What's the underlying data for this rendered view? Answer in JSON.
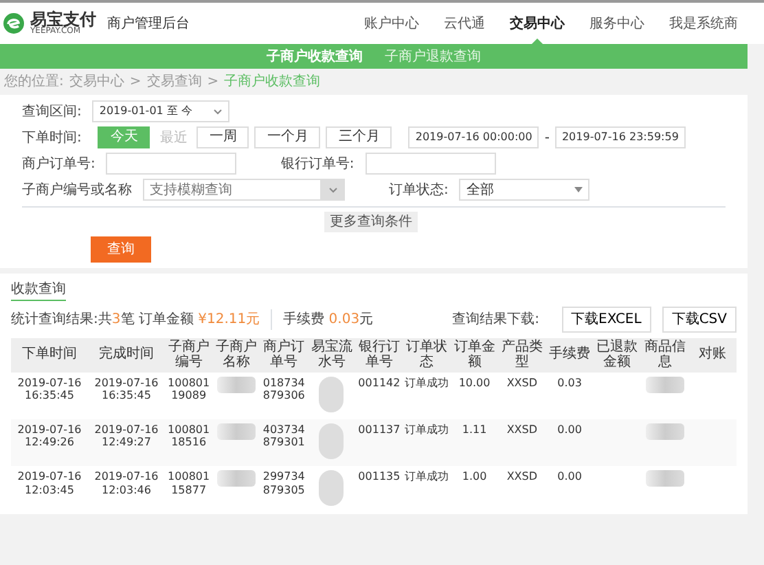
{
  "header": {
    "logo": "易宝支付",
    "logo_sub": "YEEPAY.COM",
    "title": "商户管理后台",
    "nav": [
      {
        "label": "账户中心",
        "selected": false
      },
      {
        "label": "云代通",
        "selected": false
      },
      {
        "label": "交易中心",
        "selected": true
      },
      {
        "label": "服务中心",
        "selected": false
      },
      {
        "label": "我是系统商",
        "selected": false
      }
    ]
  },
  "subnav": [
    {
      "label": "子商户收款查询",
      "selected": true
    },
    {
      "label": "子商户退款查询",
      "selected": false
    }
  ],
  "breadcrumb": {
    "prefix": "您的位置:",
    "separator": ">",
    "items": [
      "交易中心",
      "交易查询",
      "子商户收款查询"
    ]
  },
  "form": {
    "range_label": "查询区间:",
    "range_value": "2019-01-01 至 今",
    "time_label": "下单时间:",
    "quick": [
      {
        "label": "今天",
        "kind": "button",
        "selected": true
      },
      {
        "label": "最近",
        "kind": "label"
      },
      {
        "label": "一周",
        "kind": "button",
        "selected": false
      },
      {
        "label": "一个月",
        "kind": "button",
        "selected": false
      },
      {
        "label": "三个月",
        "kind": "button",
        "selected": false
      }
    ],
    "time_from": "2019-07-16 00:00:00",
    "time_sep": "-",
    "time_to": "2019-07-16 23:59:59",
    "merchant_order_label": "商户订单号:",
    "bank_order_label": "银行订单号:",
    "sub_merchant_label": "子商户编号或名称",
    "sub_merchant_placeholder": "支持模糊查询",
    "status_label": "订单状态:",
    "status_value": "全部",
    "more": "更多查询条件",
    "submit": "查询"
  },
  "results": {
    "tab": "收款查询",
    "stats_prefix": "统计查询结果:共",
    "count": "3",
    "stats_mid": "笔 订单金额",
    "amount": "¥12.11元",
    "fee_label": "手续费",
    "fee": "0.03",
    "fee_unit": "元",
    "download_label": "查询结果下载:",
    "downloads": [
      "下载EXCEL",
      "下载CSV"
    ]
  },
  "table": {
    "columns": [
      "下单时间",
      "完成时间",
      "子商户编号",
      "子商户名称",
      "商户订单号",
      "易宝流水号",
      "银行订单号",
      "订单状态",
      "订单金额",
      "产品类型",
      "手续费",
      "已退款金额",
      "商品信息",
      "对账"
    ],
    "rows": [
      {
        "cells": [
          {
            "text": "2019-07-16 16:35:45"
          },
          {
            "text": "2019-07-16 16:35:45"
          },
          {
            "text": "10080119089"
          },
          {
            "kind": "redacted"
          },
          {
            "text": "018734879306"
          },
          {
            "kind": "redacted"
          },
          {
            "text": "001142"
          },
          {
            "text": "订单成功"
          },
          {
            "text": "10.00"
          },
          {
            "text": "XXSD"
          },
          {
            "text": "0.03"
          },
          {
            "kind": "empty"
          },
          {
            "kind": "redacted"
          },
          {
            "kind": "empty"
          }
        ]
      },
      {
        "cells": [
          {
            "text": "2019-07-16 12:49:26"
          },
          {
            "text": "2019-07-16 12:49:27"
          },
          {
            "text": "10080118516"
          },
          {
            "kind": "redacted"
          },
          {
            "text": "403734879301"
          },
          {
            "kind": "redacted"
          },
          {
            "text": "001137"
          },
          {
            "text": "订单成功"
          },
          {
            "text": "1.11"
          },
          {
            "text": "XXSD"
          },
          {
            "text": "0.00"
          },
          {
            "kind": "empty"
          },
          {
            "kind": "redacted"
          },
          {
            "kind": "empty"
          }
        ]
      },
      {
        "cells": [
          {
            "text": "2019-07-16 12:03:45"
          },
          {
            "text": "2019-07-16 12:03:46"
          },
          {
            "text": "10080115877"
          },
          {
            "kind": "redacted"
          },
          {
            "text": "299734879305"
          },
          {
            "kind": "redacted"
          },
          {
            "text": "001135"
          },
          {
            "text": "订单成功"
          },
          {
            "text": "1.00"
          },
          {
            "text": "XXSD"
          },
          {
            "text": "0.00"
          },
          {
            "kind": "empty"
          },
          {
            "kind": "redacted"
          },
          {
            "kind": "empty"
          }
        ]
      }
    ]
  }
}
